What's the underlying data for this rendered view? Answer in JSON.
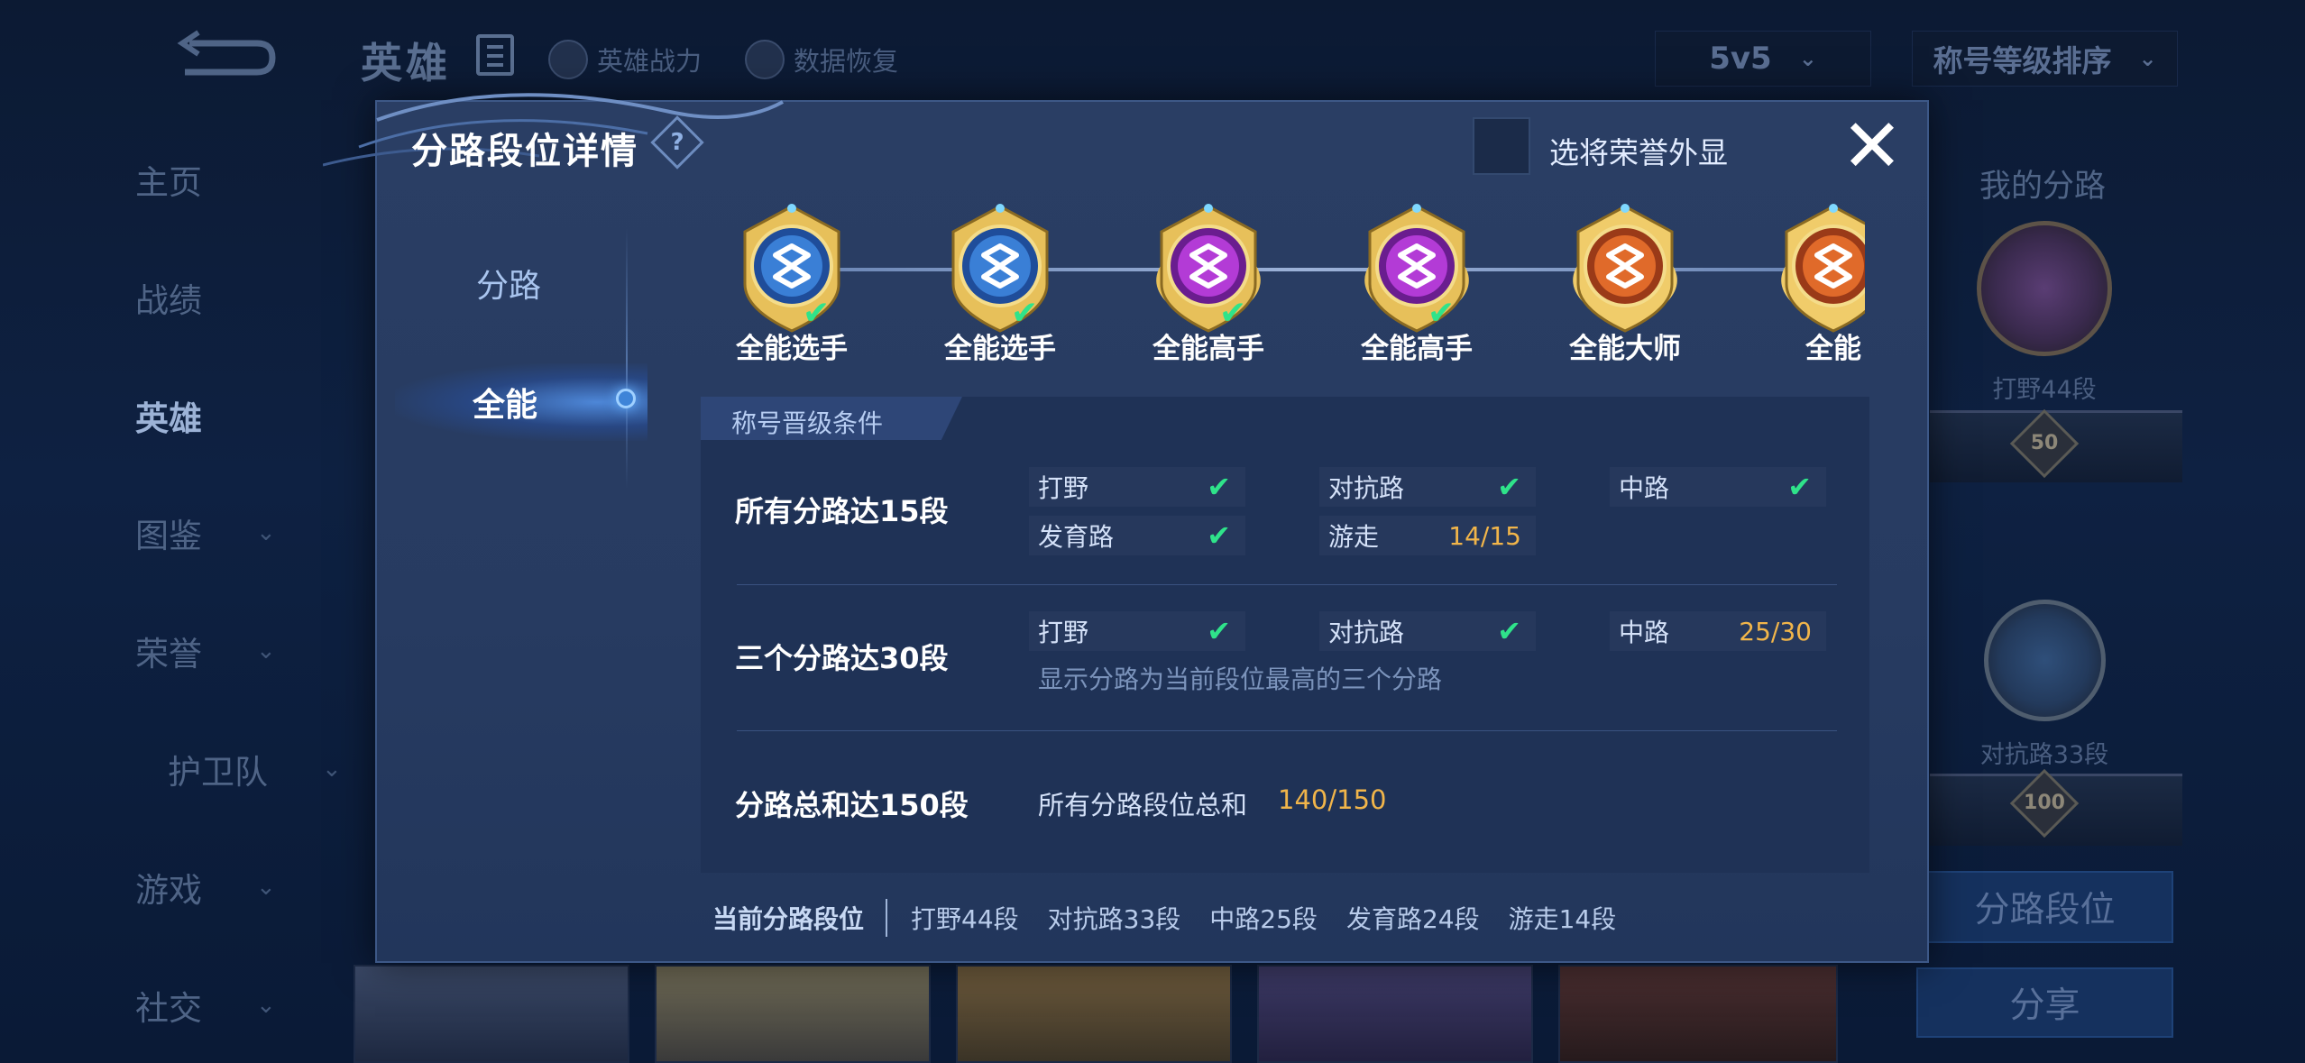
{
  "background": {
    "title": "英雄",
    "tools": [
      {
        "label": "英雄战力",
        "icon": "helmet-icon"
      },
      {
        "label": "数据恢复",
        "icon": "restore-icon"
      }
    ],
    "mode_select": {
      "value": "5v5"
    },
    "sort_select": {
      "value": "称号等级排序"
    },
    "nav": [
      {
        "label": "主页",
        "has_arrow": false,
        "active": false
      },
      {
        "label": "战绩",
        "has_arrow": false,
        "active": false
      },
      {
        "label": "英雄",
        "has_arrow": false,
        "active": true
      },
      {
        "label": "图鉴",
        "has_arrow": true,
        "active": false
      },
      {
        "label": "荣誉",
        "has_arrow": true,
        "active": false
      },
      {
        "label": "护卫队",
        "has_arrow": true,
        "active": false
      },
      {
        "label": "游戏",
        "has_arrow": true,
        "active": false
      },
      {
        "label": "社交",
        "has_arrow": true,
        "active": false
      }
    ],
    "my_lanes_title": "我的分路",
    "my_lanes": [
      {
        "label": "打野44段",
        "level": "50"
      },
      {
        "label": "对抗路33段",
        "level": "100"
      }
    ],
    "buttons": {
      "lane_rank": "分路段位",
      "share": "分享"
    }
  },
  "modal": {
    "title": "分路段位详情",
    "help_icon": "?",
    "honor_checkbox": {
      "label": "选将荣誉外显",
      "checked": false
    },
    "close_icon": "✕",
    "tabs": [
      {
        "label": "分路",
        "active": false
      },
      {
        "label": "全能",
        "active": true
      }
    ],
    "titles": [
      {
        "name": "全能选手",
        "tier": "blue",
        "achieved": true
      },
      {
        "name": "全能选手",
        "tier": "blue",
        "achieved": true
      },
      {
        "name": "全能高手",
        "tier": "purple",
        "achieved": true
      },
      {
        "name": "全能高手",
        "tier": "purple",
        "achieved": true
      },
      {
        "name": "全能大师",
        "tier": "orange",
        "achieved": false
      },
      {
        "name": "全能",
        "tier": "orange",
        "achieved": false
      }
    ],
    "conditions_header": "称号晋级条件",
    "conditions": [
      {
        "title": "所有分路达15段",
        "items": [
          {
            "lane": "打野",
            "done": true,
            "progress": ""
          },
          {
            "lane": "对抗路",
            "done": true,
            "progress": ""
          },
          {
            "lane": "中路",
            "done": true,
            "progress": ""
          },
          {
            "lane": "发育路",
            "done": true,
            "progress": ""
          },
          {
            "lane": "游走",
            "done": false,
            "progress": "14/15"
          }
        ]
      },
      {
        "title": "三个分路达30段",
        "items": [
          {
            "lane": "打野",
            "done": true,
            "progress": ""
          },
          {
            "lane": "对抗路",
            "done": true,
            "progress": ""
          },
          {
            "lane": "中路",
            "done": false,
            "progress": "25/30"
          }
        ],
        "note": "显示分路为当前段位最高的三个分路"
      },
      {
        "title": "分路总和达150段",
        "sum_label": "所有分路段位总和",
        "sum_value": "140/150"
      }
    ],
    "footer": {
      "lead": "当前分路段位",
      "stats": [
        "打野44段",
        "对抗路33段",
        "中路25段",
        "发育路24段",
        "游走14段"
      ]
    }
  },
  "colors": {
    "success": "#2fe38a",
    "progress": "#f1b54a",
    "modal_bg": "#273b61",
    "panel_bg": "#1f3256"
  }
}
